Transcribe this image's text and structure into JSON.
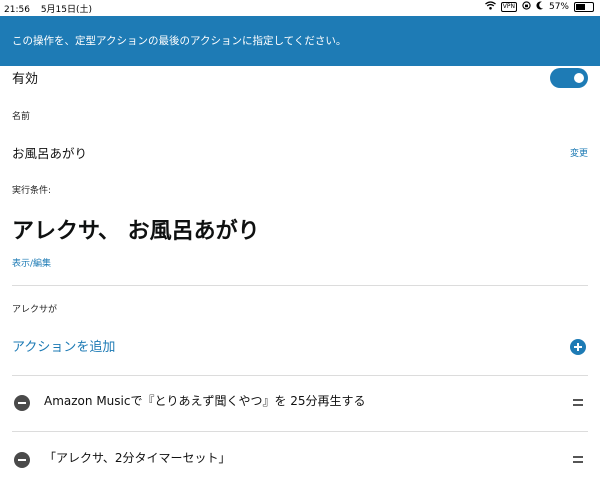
{
  "status_bar": {
    "time": "21:56",
    "date": "5月15日(土)",
    "vpn_label": "VPN",
    "battery_percent": "57%",
    "battery_level": 0.57
  },
  "banner": {
    "message": "この操作を、定型アクションの最後のアクションに指定してください。",
    "background_color": "#1e7bb5"
  },
  "enabled": {
    "label": "有効",
    "state": "on"
  },
  "name_section": {
    "label": "名前",
    "value": "お風呂あがり",
    "change_link": "変更"
  },
  "trigger_section": {
    "label": "実行条件:",
    "phrase": "アレクサ、 お風呂あがり",
    "view_edit_link": "表示/編集"
  },
  "actions_section": {
    "label": "アレクサが",
    "add_action_label": "アクションを追加",
    "items": [
      {
        "text": "Amazon Musicで『とりあえず聞くやつ』を 25分再生する"
      },
      {
        "text": "「アレクサ、2分タイマーセット」"
      }
    ]
  },
  "colors": {
    "accent": "#1e7bb5",
    "text": "#0f1111",
    "divider": "#dcdcdc"
  }
}
